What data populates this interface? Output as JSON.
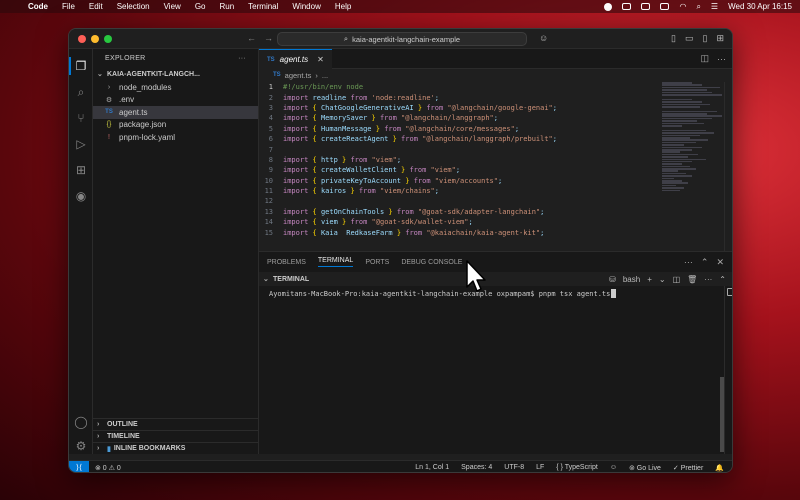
{
  "menubar": {
    "app": "Code",
    "items": [
      "File",
      "Edit",
      "Selection",
      "View",
      "Go",
      "Run",
      "Terminal",
      "Window",
      "Help"
    ],
    "datetime": "Wed 30 Apr  16:15"
  },
  "window": {
    "search_text": "kaia-agentkit-langchain-example"
  },
  "sidebar": {
    "title": "EXPLORER",
    "more": "···",
    "folder": "KAIA-AGENTKIT-LANGCH...",
    "items": [
      {
        "label": "node_modules",
        "icon": "›"
      },
      {
        "label": ".env",
        "icon": "⚙"
      },
      {
        "label": "agent.ts",
        "icon": "TS"
      },
      {
        "label": "package.json",
        "icon": "{}"
      },
      {
        "label": "pnpm-lock.yaml",
        "icon": "!"
      }
    ],
    "outline": "OUTLINE",
    "timeline": "TIMELINE",
    "bookmarks": "INLINE BOOKMARKS"
  },
  "editor": {
    "tab_label": "agent.ts",
    "tab_icon": "TS",
    "breadcrumb_file": "agent.ts",
    "breadcrumb_more": "...",
    "lines": [
      {
        "n": "1",
        "parts": [
          {
            "c": "cm",
            "t": "#!/usr/bin/env node"
          }
        ]
      },
      {
        "n": "2",
        "parts": [
          {
            "c": "kw",
            "t": "import "
          },
          {
            "c": "id",
            "t": "readline "
          },
          {
            "c": "kw",
            "t": "from "
          },
          {
            "c": "str",
            "t": "'node:readline'"
          },
          {
            "c": "id",
            "t": ";"
          }
        ]
      },
      {
        "n": "3",
        "parts": [
          {
            "c": "kw",
            "t": "import "
          },
          {
            "c": "br",
            "t": "{ "
          },
          {
            "c": "id",
            "t": "ChatGoogleGenerativeAI "
          },
          {
            "c": "br",
            "t": "} "
          },
          {
            "c": "kw",
            "t": "from "
          },
          {
            "c": "str",
            "t": "\"@langchain/google-genai\""
          },
          {
            "c": "id",
            "t": ";"
          }
        ]
      },
      {
        "n": "4",
        "parts": [
          {
            "c": "kw",
            "t": "import "
          },
          {
            "c": "br",
            "t": "{ "
          },
          {
            "c": "id",
            "t": "MemorySaver "
          },
          {
            "c": "br",
            "t": "} "
          },
          {
            "c": "kw",
            "t": "from "
          },
          {
            "c": "str",
            "t": "\"@langchain/langgraph\""
          },
          {
            "c": "id",
            "t": ";"
          }
        ]
      },
      {
        "n": "5",
        "parts": [
          {
            "c": "kw",
            "t": "import "
          },
          {
            "c": "br",
            "t": "{ "
          },
          {
            "c": "id",
            "t": "HumanMessage "
          },
          {
            "c": "br",
            "t": "} "
          },
          {
            "c": "kw",
            "t": "from "
          },
          {
            "c": "str",
            "t": "\"@langchain/core/messages\""
          },
          {
            "c": "id",
            "t": ";"
          }
        ]
      },
      {
        "n": "6",
        "parts": [
          {
            "c": "kw",
            "t": "import "
          },
          {
            "c": "br",
            "t": "{ "
          },
          {
            "c": "id",
            "t": "createReactAgent "
          },
          {
            "c": "br",
            "t": "} "
          },
          {
            "c": "kw",
            "t": "from "
          },
          {
            "c": "str",
            "t": "\"@langchain/langgraph/prebuilt\""
          },
          {
            "c": "id",
            "t": ";"
          }
        ]
      },
      {
        "n": "7",
        "parts": []
      },
      {
        "n": "8",
        "parts": [
          {
            "c": "kw",
            "t": "import "
          },
          {
            "c": "br",
            "t": "{ "
          },
          {
            "c": "id",
            "t": "http "
          },
          {
            "c": "br",
            "t": "} "
          },
          {
            "c": "kw",
            "t": "from "
          },
          {
            "c": "str",
            "t": "\"viem\""
          },
          {
            "c": "id",
            "t": ";"
          }
        ]
      },
      {
        "n": "9",
        "parts": [
          {
            "c": "kw",
            "t": "import "
          },
          {
            "c": "br",
            "t": "{ "
          },
          {
            "c": "id",
            "t": "createWalletClient "
          },
          {
            "c": "br",
            "t": "} "
          },
          {
            "c": "kw",
            "t": "from "
          },
          {
            "c": "str",
            "t": "\"viem\""
          },
          {
            "c": "id",
            "t": ";"
          }
        ]
      },
      {
        "n": "10",
        "parts": [
          {
            "c": "kw",
            "t": "import "
          },
          {
            "c": "br",
            "t": "{ "
          },
          {
            "c": "id",
            "t": "privateKeyToAccount "
          },
          {
            "c": "br",
            "t": "} "
          },
          {
            "c": "kw",
            "t": "from "
          },
          {
            "c": "str",
            "t": "\"viem/accounts\""
          },
          {
            "c": "id",
            "t": ";"
          }
        ]
      },
      {
        "n": "11",
        "parts": [
          {
            "c": "kw",
            "t": "import "
          },
          {
            "c": "br",
            "t": "{ "
          },
          {
            "c": "id",
            "t": "kairos "
          },
          {
            "c": "br",
            "t": "} "
          },
          {
            "c": "kw",
            "t": "from "
          },
          {
            "c": "str",
            "t": "\"viem/chains\""
          },
          {
            "c": "id",
            "t": ";"
          }
        ]
      },
      {
        "n": "12",
        "parts": []
      },
      {
        "n": "13",
        "parts": [
          {
            "c": "kw",
            "t": "import "
          },
          {
            "c": "br",
            "t": "{ "
          },
          {
            "c": "id",
            "t": "getOnChainTools "
          },
          {
            "c": "br",
            "t": "} "
          },
          {
            "c": "kw",
            "t": "from "
          },
          {
            "c": "str",
            "t": "\"@goat-sdk/adapter-langchain\""
          },
          {
            "c": "id",
            "t": ";"
          }
        ]
      },
      {
        "n": "14",
        "parts": [
          {
            "c": "kw",
            "t": "import "
          },
          {
            "c": "br",
            "t": "{ "
          },
          {
            "c": "id",
            "t": "viem "
          },
          {
            "c": "br",
            "t": "} "
          },
          {
            "c": "kw",
            "t": "from "
          },
          {
            "c": "str",
            "t": "\"@goat-sdk/wallet-viem\""
          },
          {
            "c": "id",
            "t": ";"
          }
        ]
      },
      {
        "n": "15",
        "parts": [
          {
            "c": "kw",
            "t": "import "
          },
          {
            "c": "br",
            "t": "{ "
          },
          {
            "c": "id",
            "t": "Kaia  RedkaseFarm "
          },
          {
            "c": "br",
            "t": "} "
          },
          {
            "c": "kw",
            "t": "from "
          },
          {
            "c": "str",
            "t": "\"@kaiachain/kaia-agent-kit\""
          },
          {
            "c": "id",
            "t": ";"
          }
        ]
      }
    ]
  },
  "panel": {
    "tabs": [
      "PROBLEMS",
      "TERMINAL",
      "PORTS",
      "DEBUG CONSOLE"
    ],
    "terminal_title": "TERMINAL",
    "shell": "bash",
    "prompt": "Ayomitans-MacBook-Pro:kaia-agentkit-langchain-example oxpampam$ ",
    "command": "pnpm tsx agent.ts"
  },
  "statusbar": {
    "problems": "⊗ 0 ⚠ 0",
    "position": "Ln 1, Col 1",
    "spaces": "Spaces: 4",
    "encoding": "UTF-8",
    "eol": "LF",
    "language": "{ } TypeScript",
    "golive": "Go Live",
    "prettier": "✓ Prettier"
  },
  "colors": {
    "accent": "#0078d4",
    "wallpaper": "#a5121c"
  }
}
